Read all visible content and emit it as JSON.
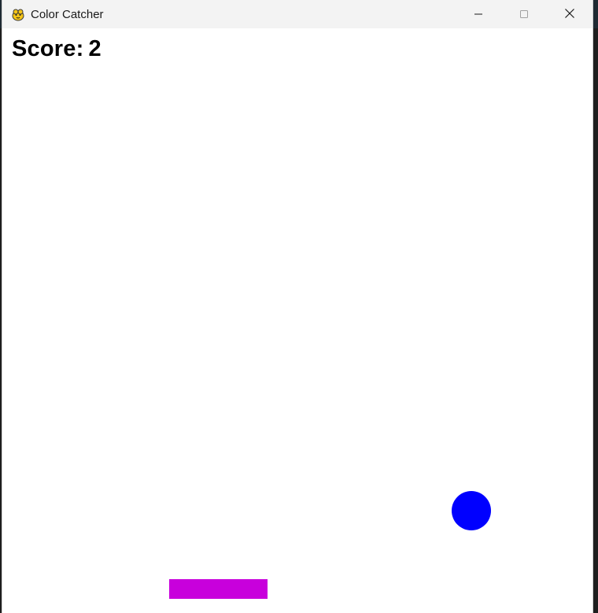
{
  "window": {
    "title": "Color Catcher",
    "app_icon": "pygame-snake-icon",
    "controls": {
      "minimize_icon": "minimize-icon",
      "maximize_icon": "maximize-icon",
      "close_icon": "close-icon"
    }
  },
  "game": {
    "score_label": "Score:",
    "score_value": "2",
    "ball": {
      "color": "#0000ff"
    },
    "paddle": {
      "color": "#c800dc"
    },
    "background_color": "#ffffff"
  }
}
